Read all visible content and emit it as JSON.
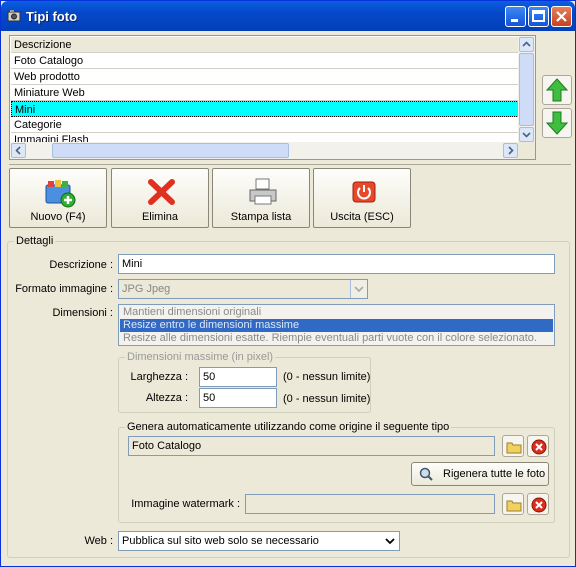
{
  "window": {
    "title": "Tipi foto"
  },
  "list": {
    "header": "Descrizione",
    "items": [
      "Foto Catalogo",
      "Web prodotto",
      "Miniature Web",
      "Mini",
      "Categorie",
      "Immagini Flash"
    ],
    "selected_index": 3
  },
  "toolbar": {
    "new_label": "Nuovo (F4)",
    "delete_label": "Elimina",
    "print_label": "Stampa lista",
    "exit_label": "Uscita (ESC)"
  },
  "details": {
    "legend": "Dettagli",
    "description_label": "Descrizione :",
    "description_value": "Mini",
    "format_label": "Formato immagine :",
    "format_value": "JPG Jpeg",
    "dimensions_label": "Dimensioni :",
    "dimension_options": [
      "Mantieni dimensioni originali",
      "Resize entro le dimensioni massime",
      "Resize alle dimensioni esatte. Riempie eventuali parti vuote con il colore selezionato."
    ],
    "max_dims": {
      "legend": "Dimensioni massime (in pixel)",
      "width_label": "Larghezza :",
      "width_value": "50",
      "width_hint": "(0 - nessun limite)",
      "height_label": "Altezza :",
      "height_value": "50",
      "height_hint": "(0 - nessun limite)"
    },
    "auto_gen": {
      "legend": "Genera automaticamente utilizzando come origine il seguente tipo",
      "source_value": "Foto Catalogo",
      "regen_label": "Rigenera tutte le foto",
      "watermark_label": "Immagine watermark :",
      "watermark_value": ""
    },
    "web_label": "Web :",
    "web_value": "Pubblica sul sito web solo se necessario"
  }
}
